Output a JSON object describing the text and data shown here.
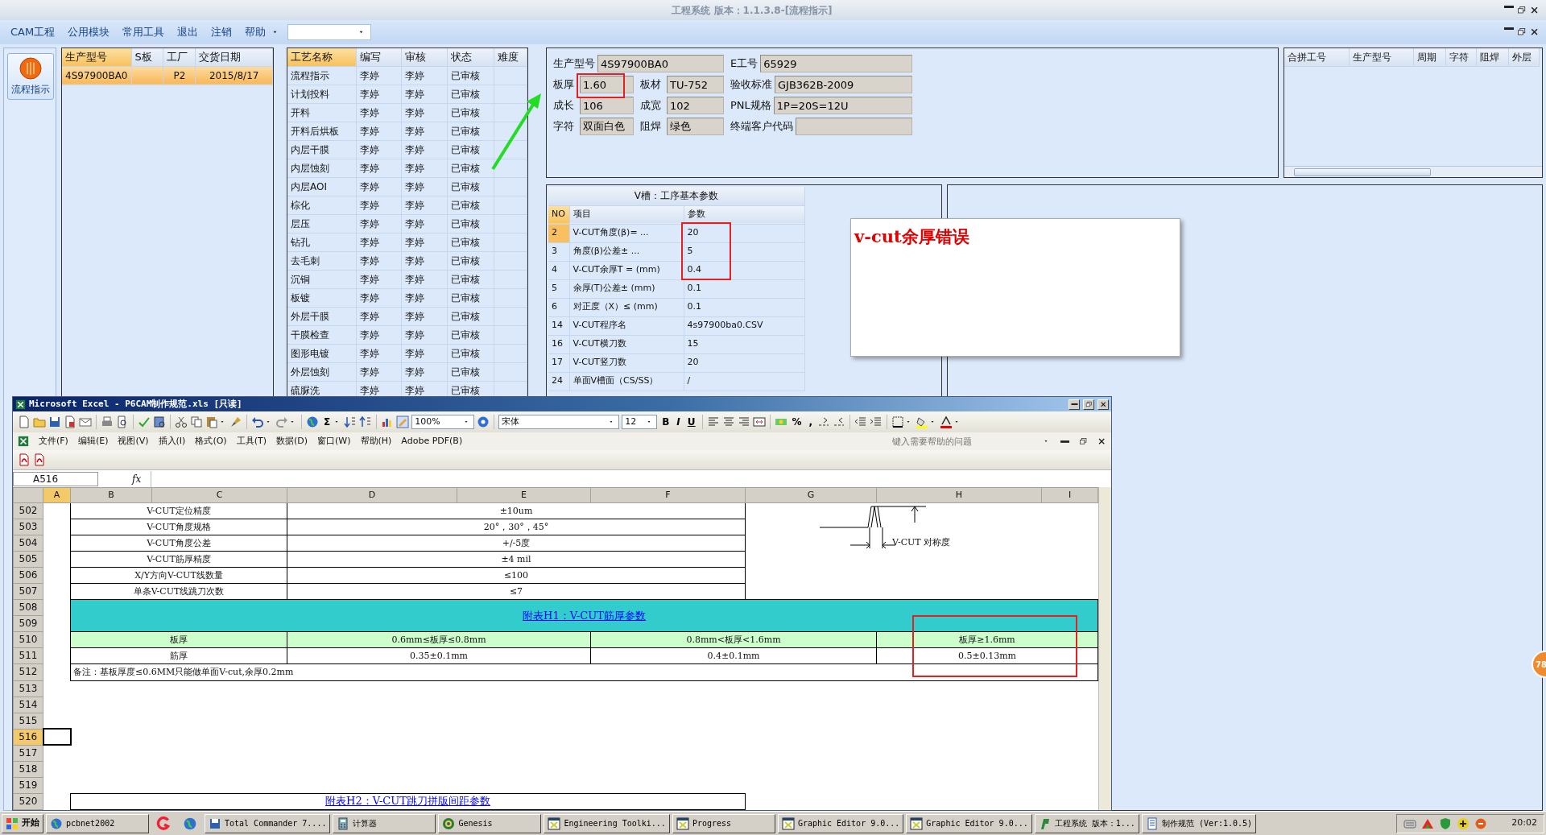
{
  "app": {
    "title": "工程系统 版本：1.1.3.8-[流程指示]"
  },
  "menu": [
    {
      "label": "CAM工程"
    },
    {
      "label": "公用模块"
    },
    {
      "label": "常用工具"
    },
    {
      "label": "退出"
    },
    {
      "label": "注销"
    },
    {
      "label": "帮助"
    }
  ],
  "sidebar": {
    "label": "流程指示"
  },
  "orders": {
    "columns": [
      {
        "label": "生产型号",
        "sorted": true
      },
      {
        "label": "S板",
        "sorted": false
      },
      {
        "label": "工厂",
        "sorted": false
      },
      {
        "label": "交货日期",
        "sorted": false
      }
    ],
    "rows": [
      {
        "model": "4S97900BA0",
        "factory": "P2",
        "date": "2015/8/17",
        "selected": true
      }
    ]
  },
  "processes": {
    "columns": [
      {
        "label": "工艺名称",
        "sorted": true
      },
      {
        "label": "编写",
        "sorted": false
      },
      {
        "label": "审核",
        "sorted": false
      },
      {
        "label": "状态",
        "sorted": false
      },
      {
        "label": "难度",
        "sorted": false
      }
    ],
    "rows": [
      {
        "name": "流程指示",
        "author": "李婷",
        "reviewer": "李婷",
        "status": "已审核"
      },
      {
        "name": "计划投料",
        "author": "李婷",
        "reviewer": "李婷",
        "status": "已审核"
      },
      {
        "name": "开料",
        "author": "李婷",
        "reviewer": "李婷",
        "status": "已审核"
      },
      {
        "name": "开料后烘板",
        "author": "李婷",
        "reviewer": "李婷",
        "status": "已审核"
      },
      {
        "name": "内层干膜",
        "author": "李婷",
        "reviewer": "李婷",
        "status": "已审核"
      },
      {
        "name": "内层蚀刻",
        "author": "李婷",
        "reviewer": "李婷",
        "status": "已审核"
      },
      {
        "name": "内层AOI",
        "author": "李婷",
        "reviewer": "李婷",
        "status": "已审核"
      },
      {
        "name": "棕化",
        "author": "李婷",
        "reviewer": "李婷",
        "status": "已审核"
      },
      {
        "name": "层压",
        "author": "李婷",
        "reviewer": "李婷",
        "status": "已审核"
      },
      {
        "name": "钻孔",
        "author": "李婷",
        "reviewer": "李婷",
        "status": "已审核"
      },
      {
        "name": "去毛刺",
        "author": "李婷",
        "reviewer": "李婷",
        "status": "已审核"
      },
      {
        "name": "沉铜",
        "author": "李婷",
        "reviewer": "李婷",
        "status": "已审核"
      },
      {
        "name": "板镀",
        "author": "李婷",
        "reviewer": "李婷",
        "status": "已审核"
      },
      {
        "name": "外层干膜",
        "author": "李婷",
        "reviewer": "李婷",
        "status": "已审核"
      },
      {
        "name": "干膜检查",
        "author": "李婷",
        "reviewer": "李婷",
        "status": "已审核"
      },
      {
        "name": "图形电镀",
        "author": "李婷",
        "reviewer": "李婷",
        "status": "已审核"
      },
      {
        "name": "外层蚀刻",
        "author": "李婷",
        "reviewer": "李婷",
        "status": "已审核"
      },
      {
        "name": "硫脲洗",
        "author": "李婷",
        "reviewer": "李婷",
        "status": "已审核"
      }
    ]
  },
  "info": {
    "rows": [
      {
        "fields": [
          {
            "label": "生产型号",
            "value": "4S97900BA0"
          },
          {
            "label": "E工号",
            "value": "65929"
          }
        ]
      },
      {
        "fields": [
          {
            "label": "板厚",
            "value": "1.60"
          },
          {
            "label": "板材",
            "value": "TU-752"
          },
          {
            "label": "验收标准",
            "value": "GJB362B-2009"
          }
        ]
      },
      {
        "fields": [
          {
            "label": "成长",
            "value": "106"
          },
          {
            "label": "成宽",
            "value": "102"
          },
          {
            "label": "PNL规格",
            "value": "1P=20S=12U"
          }
        ]
      },
      {
        "fields": [
          {
            "label": "字符",
            "value": "双面白色"
          },
          {
            "label": "阻焊",
            "value": "绿色"
          },
          {
            "label": "终端客户代码"
          }
        ]
      }
    ]
  },
  "merge_table": {
    "columns": [
      "合拼工号",
      "生产型号",
      "周期",
      "字符",
      "阻焊",
      "外层"
    ]
  },
  "vgroove": {
    "title": "V槽：工序基本参数",
    "columns": [
      "NO",
      "项目",
      "参数"
    ],
    "rows": [
      {
        "no": "2",
        "item": "V-CUT角度(β)=   ...",
        "value": "20",
        "selected": true
      },
      {
        "no": "3",
        "item": "角度(β)公差±   ...",
        "value": "5",
        "selected": false
      },
      {
        "no": "4",
        "item": "V-CUT余厚T =  (mm)",
        "value": "0.4",
        "selected": false
      },
      {
        "no": "5",
        "item": "余厚(T)公差±  (mm)",
        "value": "0.1",
        "selected": false
      },
      {
        "no": "6",
        "item": "对正度（X）≤ (mm)",
        "value": "0.1",
        "selected": false
      },
      {
        "no": "14",
        "item": "V-CUT程序名",
        "value": "4s97900ba0.CSV",
        "selected": false
      },
      {
        "no": "16",
        "item": "V-CUT横刀数",
        "value": "15",
        "selected": false
      },
      {
        "no": "17",
        "item": "V-CUT竖刀数",
        "value": "20",
        "selected": false
      },
      {
        "no": "24",
        "item": "单面V槽面（CS/SS）",
        "value": "/",
        "selected": false
      }
    ]
  },
  "note": {
    "text": "v-cut余厚错误"
  },
  "edge_badge": {
    "text": "78"
  },
  "excel": {
    "title": "Microsoft Excel - P6CAM制作规范.xls  [只读]",
    "toolbar": {
      "sum": "Σ",
      "zoom": "100%",
      "font": "宋体",
      "size": "12",
      "bold": "B",
      "italic": "I",
      "underline": "U",
      "percent": "%",
      "comma": ","
    },
    "menu": [
      "文件(F)",
      "编辑(E)",
      "视图(V)",
      "插入(I)",
      "格式(O)",
      "工具(T)",
      "数据(D)",
      "窗口(W)",
      "帮助(H)",
      "Adobe PDF(B)"
    ],
    "help_placeholder": "键入需要帮助的问题",
    "name_box": "A516",
    "fx": "fx",
    "columns": [
      {
        "label": "A",
        "selected": true
      },
      {
        "label": "B",
        "selected": false
      },
      {
        "label": "C",
        "selected": false
      },
      {
        "label": "D",
        "selected": false
      },
      {
        "label": "E",
        "selected": false
      },
      {
        "label": "F",
        "selected": false
      },
      {
        "label": "G",
        "selected": false
      },
      {
        "label": "H",
        "selected": false
      },
      {
        "label": "I",
        "selected": false
      }
    ],
    "diagram": {
      "label": "V-CUT 对称度"
    },
    "rows": [
      {
        "n": "502",
        "kind": "spec",
        "item": "V-CUT定位精度",
        "value": "±10um",
        "selected": false
      },
      {
        "n": "503",
        "kind": "spec",
        "item": "V-CUT角度规格",
        "value": "20°，30°，45°",
        "selected": false
      },
      {
        "n": "504",
        "kind": "spec",
        "item": "V-CUT角度公差",
        "value": "+/-5度",
        "selected": false
      },
      {
        "n": "505",
        "kind": "spec",
        "item": "V-CUT筋厚精度",
        "value": "±4 mil",
        "selected": false
      },
      {
        "n": "506",
        "kind": "spec",
        "item": "X/Y方向V-CUT线数量",
        "value": "≤100",
        "selected": false
      },
      {
        "n": "507",
        "kind": "spec",
        "item": "单条V-CUT线跳刀次数",
        "value": "≤7",
        "selected": false
      },
      {
        "n": "508",
        "kind": "band",
        "title": "附表H1：V-CUT筋厚参数",
        "selected": false
      },
      {
        "n": "509",
        "kind": "band-cont",
        "selected": false
      },
      {
        "n": "510",
        "kind": "grid-head",
        "cells": [
          "板厚",
          "0.6mm≤板厚≤0.8mm",
          "0.8mm<板厚<1.6mm",
          "板厚≥1.6mm"
        ],
        "selected": false
      },
      {
        "n": "511",
        "kind": "grid-row",
        "cells": [
          "筋厚",
          "0.35±0.1mm",
          "0.4±0.1mm",
          "0.5±0.13mm"
        ],
        "selected": false
      },
      {
        "n": "512",
        "kind": "note",
        "text": "备注：基板厚度≤0.6MM只能做单面V-cut,余厚0.2mm",
        "selected": false
      },
      {
        "n": "513",
        "kind": "blank",
        "selected": false
      },
      {
        "n": "514",
        "kind": "blank",
        "selected": false
      },
      {
        "n": "515",
        "kind": "blank",
        "selected": false
      },
      {
        "n": "516",
        "kind": "blank",
        "selected": true
      },
      {
        "n": "517",
        "kind": "blank",
        "selected": false
      },
      {
        "n": "518",
        "kind": "blank",
        "selected": false
      },
      {
        "n": "519",
        "kind": "blank",
        "selected": false
      },
      {
        "n": "520",
        "kind": "title",
        "title": "附表H2：V-CUT跳刀拼版间距参数",
        "selected": false
      }
    ]
  },
  "taskbar": {
    "start": "开始",
    "clock": "20:02",
    "tasks": [
      {
        "kind": "globe",
        "label": "pcbnet2002"
      },
      {
        "kind": "swirl"
      },
      {
        "kind": "globe"
      },
      {
        "kind": "disk",
        "label": "Total Commander 7...."
      },
      {
        "kind": "calculator",
        "label": "计算器"
      },
      {
        "kind": "genesis",
        "label": "Genesis"
      },
      {
        "kind": "graphic",
        "label": "Engineering Toolki..."
      },
      {
        "kind": "graphic",
        "label": "Progress"
      },
      {
        "kind": "graphic",
        "label": "Graphic Editor 9.0..."
      },
      {
        "kind": "graphic",
        "label": "Graphic Editor 9.0..."
      },
      {
        "kind": "app",
        "label": "工程系统    版本：1..."
      },
      {
        "kind": "doc",
        "label": "制作规范 (Ver:1.0.5)"
      }
    ]
  }
}
